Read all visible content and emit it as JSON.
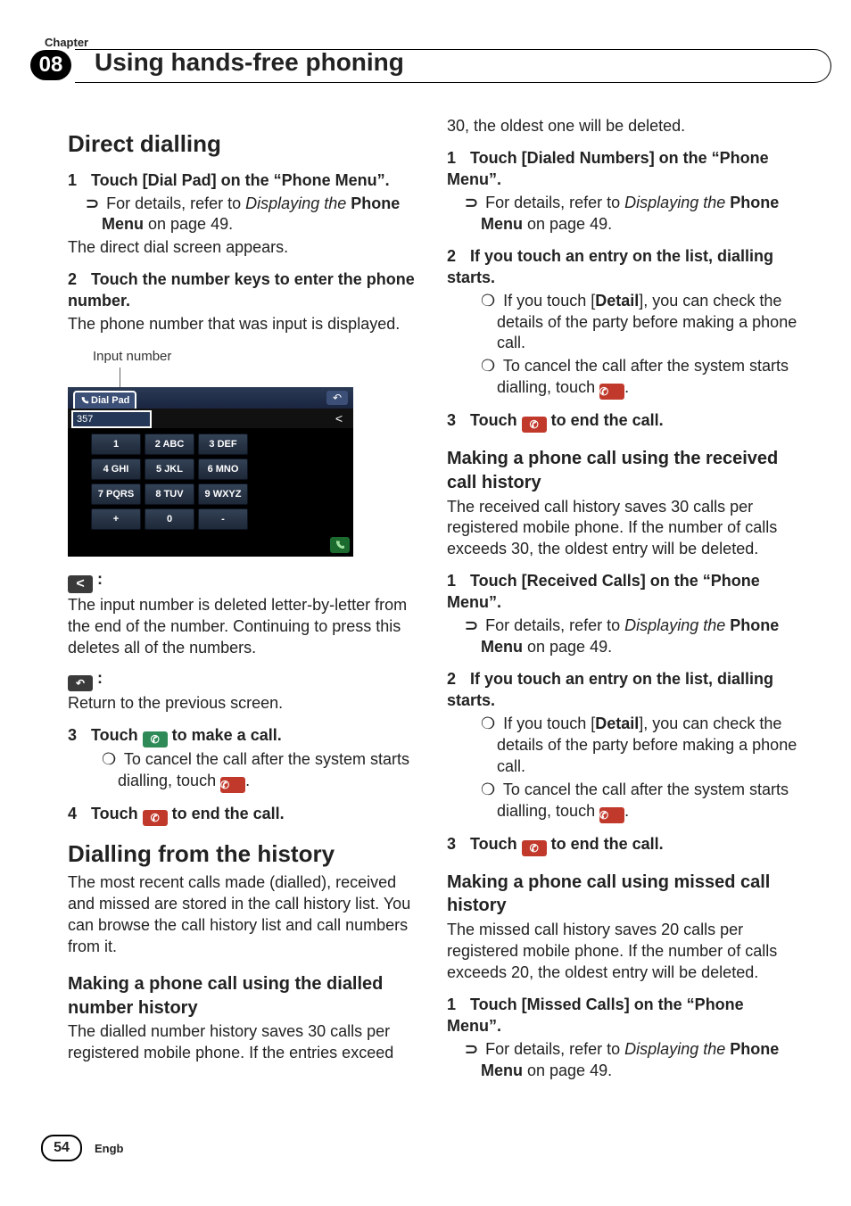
{
  "header": {
    "chapter_word": "Chapter",
    "chapter_num": "08",
    "title": "Using hands-free phoning"
  },
  "direct_dialling": {
    "h": "Direct dialling",
    "s1": {
      "num": "1",
      "t": "Touch [Dial Pad] on the “Phone Menu”."
    },
    "xref": {
      "arrow": "⊃",
      "pre": "For details, refer to ",
      "ital": "Displaying the ",
      "bold": "Phone Menu",
      "post": " on page 49."
    },
    "after1": "The direct dial screen appears.",
    "s2": {
      "num": "2",
      "t": "Touch the number keys to enter the phone number."
    },
    "after2": "The phone number that was input is displayed.",
    "callout": "Input number",
    "shot": {
      "dialpad": "Dial Pad",
      "num": "357",
      "keys": [
        "1",
        "2 ABC",
        "3 DEF",
        "4 GHI",
        "5 JKL",
        "6 MNO",
        "7 PQRS",
        "8 TUV",
        "9 WXYZ",
        "+",
        "0",
        "-"
      ]
    },
    "key_del": {
      "after": ":",
      "body": "The input number is deleted letter-by-letter from the end of the number. Continuing to press this deletes all of the numbers."
    },
    "key_back": {
      "after": ":",
      "body": "Return to the previous screen."
    },
    "s3": {
      "num": "3",
      "pre": "Touch ",
      "post": " to make a call."
    },
    "n3a": "To cancel the call after the system starts dialling, touch ",
    "s4": {
      "num": "4",
      "pre": "Touch ",
      "post": " to end the call."
    }
  },
  "history_main": {
    "h": "Dialling from the history",
    "intro": "The most recent calls made (dialled), received and missed are stored in the call history list. You can browse the call history list and call numbers from it."
  },
  "dialled_hist": {
    "h": "Making a phone call using the dialled number history",
    "body": "The dialled number history saves 30 calls per registered mobile phone. If the entries exceed 30, the oldest one will be deleted.",
    "s1": {
      "num": "1",
      "t": "Touch [Dialed Numbers] on the “Phone Menu”."
    },
    "s2": {
      "num": "2",
      "t": "If you touch an entry on the list, dialling starts."
    },
    "n2a": {
      "pre": "If you touch [",
      "bold": "Detail",
      "post": "], you can check the details of the party before making a phone call."
    },
    "n2b": "To cancel the call after the system starts dialling, touch ",
    "s3": {
      "num": "3",
      "pre": "Touch ",
      "post": " to end the call."
    }
  },
  "received_hist": {
    "h": "Making a phone call using the received call history",
    "body": "The received call history saves 30 calls per registered mobile phone. If the number of calls exceeds 30, the oldest entry will be deleted.",
    "s1": {
      "num": "1",
      "t": "Touch [Received Calls] on the “Phone Menu”."
    },
    "s2": {
      "num": "2",
      "t": "If you touch an entry on the list, dialling starts."
    },
    "n2a": {
      "pre": "If you touch [",
      "bold": "Detail",
      "post": "], you can check the details of the party before making a phone call."
    },
    "n2b": "To cancel the call after the system starts dialling, touch ",
    "s3": {
      "num": "3",
      "pre": "Touch ",
      "post": " to end the call."
    }
  },
  "missed_hist": {
    "h": "Making a phone call using missed call history",
    "body": "The missed call history saves 20 calls per registered mobile phone. If the number of calls exceeds 20, the oldest entry will be deleted.",
    "s1": {
      "num": "1",
      "t": "Touch [Missed Calls] on the “Phone Menu”."
    }
  },
  "note_bullet": "❍",
  "footer": {
    "page": "54",
    "lang": "Engb"
  }
}
